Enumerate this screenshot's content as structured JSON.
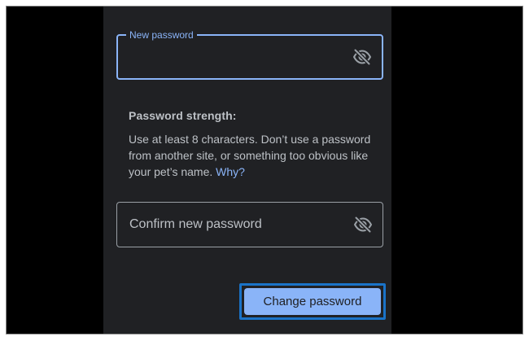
{
  "new_password": {
    "label": "New password",
    "value": "",
    "visibility_icon": "eye-off-icon"
  },
  "strength": {
    "title": "Password strength:",
    "description": "Use at least 8 characters. Don’t use a password from another site, or something too obvious like your pet’s name.",
    "link_label": "Why?"
  },
  "confirm_password": {
    "placeholder": "Confirm new password",
    "visibility_icon": "eye-off-icon"
  },
  "submit": {
    "label": "Change password"
  },
  "colors": {
    "panel_background": "#202124",
    "accent": "#8ab4f8",
    "text": "#bdc1c6",
    "focus_ring": "#1a73c8"
  }
}
